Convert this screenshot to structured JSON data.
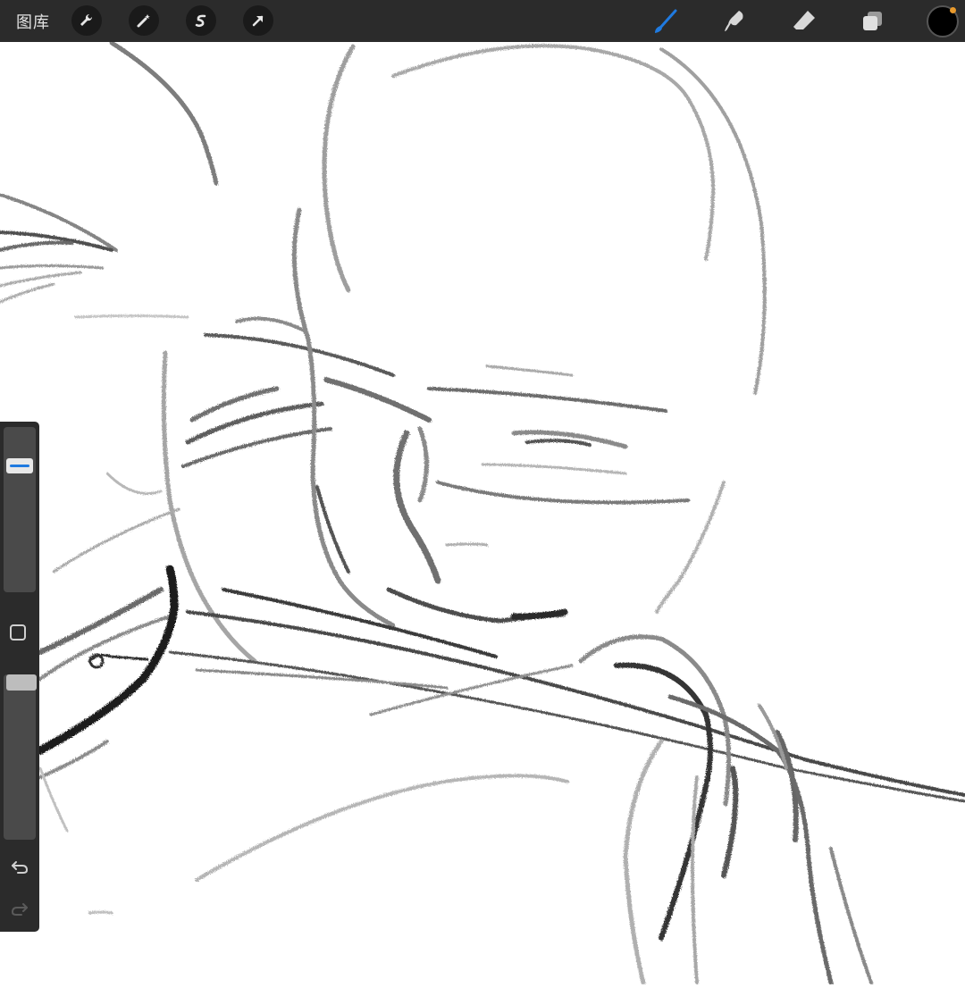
{
  "topbar": {
    "gallery_label": "图库",
    "left_tools": [
      {
        "name": "actions-wrench-icon"
      },
      {
        "name": "adjustments-magic-wand-icon"
      },
      {
        "name": "selection-s-icon"
      },
      {
        "name": "transform-arrow-icon"
      }
    ],
    "right_tools": [
      {
        "name": "brush-icon",
        "active": true,
        "color": "#1f7ae0"
      },
      {
        "name": "smudge-icon"
      },
      {
        "name": "eraser-icon"
      },
      {
        "name": "layers-icon"
      }
    ],
    "current_color": "#000000",
    "indicator_color": "#e99a2c"
  },
  "sidebar": {
    "brush_size_level": 0.79,
    "opacity_level": 1.0,
    "modify_button": "square",
    "undo": "undo-arrow-icon",
    "redo": "redo-arrow-icon"
  },
  "canvas": {
    "background": "#ffffff",
    "content": "pencil sketch"
  }
}
